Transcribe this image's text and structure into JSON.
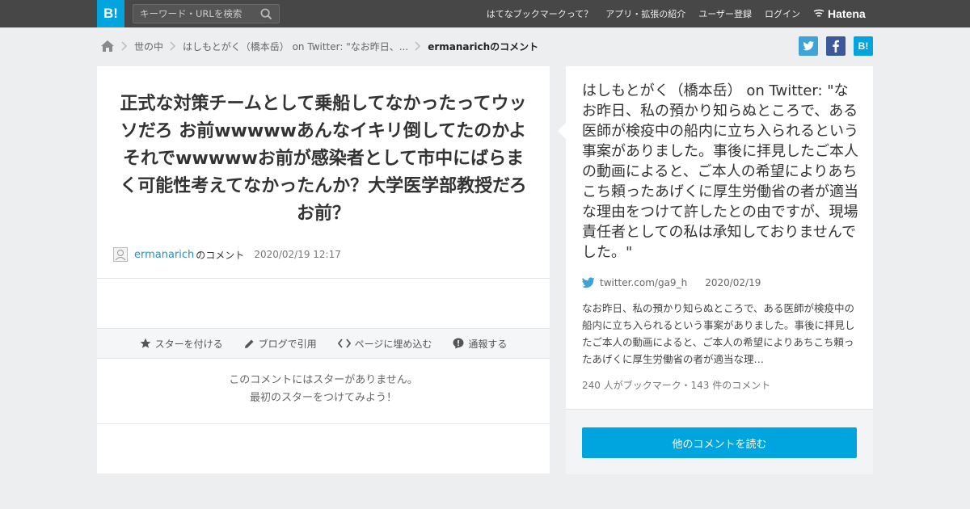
{
  "header": {
    "logo": "B!",
    "search_placeholder": "キーワード・URLを検索",
    "nav": [
      "はてなブックマークって？",
      "アプリ・拡張の紹介",
      "ユーザー登録",
      "ログイン"
    ],
    "brand": "Hatena"
  },
  "breadcrumb": {
    "items": [
      "世の中",
      "はしもとがく（橋本岳） on Twitter: \"なお昨日、..."
    ],
    "current": "ermanarichのコメント"
  },
  "comment": {
    "text": "正式な対策チームとして乗船してなかったってウッソだろ お前wwwwwあんなイキリ倒してたのかよそれでwwwwwお前が感染者として市中にばらまく可能性考えてなかったんか？大学医学部教授だろお前？",
    "user": "ermanarich",
    "user_suffix": "のコメント",
    "date": "2020/02/19 12:17"
  },
  "actions": {
    "star": "スターを付ける",
    "blog": "ブログで引用",
    "embed": "ページに埋め込む",
    "report": "通報する"
  },
  "stars": {
    "line1": "このコメントにはスターがありません。",
    "line2": "最初のスターをつけてみよう！"
  },
  "entry": {
    "title": "はしもとがく（橋本岳） on Twitter: \"なお昨日、私の預かり知らぬところで、ある医師が検疫中の船内に立ち入られるという事案がありました。事後に拝見したご本人の動画によると、ご本人の希望によりあちこち頼ったあげくに厚生労働省の者が適当な理由をつけて許したとの由ですが、現場責任者としての私は承知しておりませんでした。\"",
    "source": "twitter.com/ga9_h",
    "date": "2020/02/19",
    "excerpt": "なお昨日、私の預かり知らぬところで、ある医師が検疫中の船内に立ち入られるという事案がありました。事後に拝見したご本人の動画によると、ご本人の希望によりあちこち頼ったあげくに厚生労働省の者が適当な理…",
    "counts": "240 人がブックマーク・143 件のコメント",
    "read_more": "他のコメントを読む"
  },
  "colors": {
    "topbar": "#474747",
    "accent": "#00a4de",
    "twitter": "#3fa3d7",
    "facebook": "#3b5998",
    "link": "#2a8fbd"
  },
  "icons": [
    "search-icon",
    "hatena-logo-icon",
    "home-icon",
    "chevron-right-icon",
    "twitter-icon",
    "facebook-icon",
    "star-icon",
    "pencil-icon",
    "code-icon",
    "alert-icon"
  ]
}
